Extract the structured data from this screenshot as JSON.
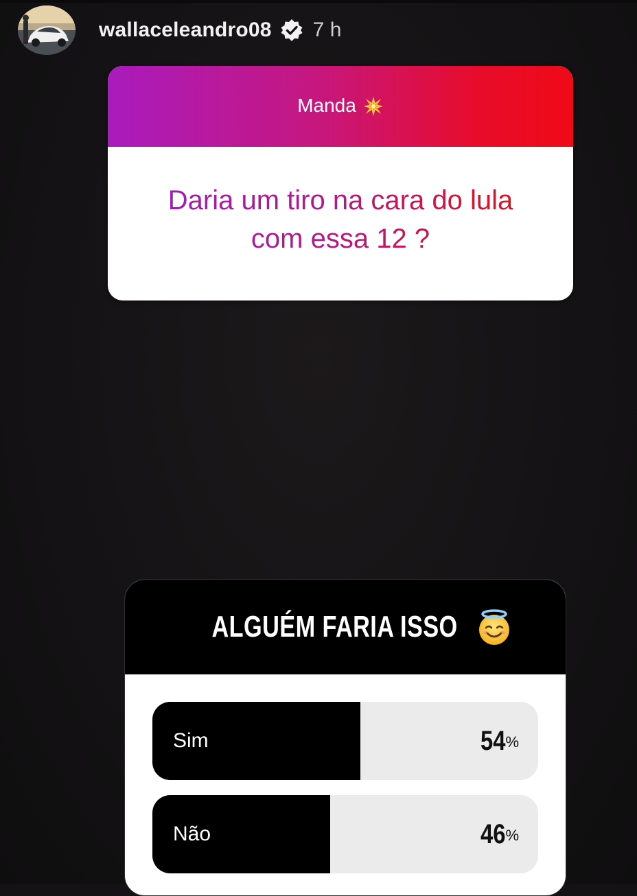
{
  "header": {
    "username": "wallaceleandro08",
    "time": "7 h",
    "avatar_icon": "profile-avatar-car",
    "verified_icon": "verified-badge-icon"
  },
  "question_sticker": {
    "prompt": "Manda",
    "prompt_icon": "sparkle-collision-emoji",
    "text": "Daria um tiro na cara do lula com essa 12 ?",
    "gradient": [
      "#a91bbd",
      "#ef0a16"
    ]
  },
  "poll": {
    "title": "ALGUÉM FARIA ISSO",
    "title_icon": "smiling-face-with-halo-emoji",
    "options": [
      {
        "label": "Sim",
        "percent_value": "54",
        "percent_sign": "%",
        "fill": 0.54
      },
      {
        "label": "Não",
        "percent_value": "46",
        "percent_sign": "%",
        "fill": 0.46
      }
    ]
  },
  "colors": {
    "background": "#141214",
    "poll_fill": "#000000",
    "poll_track": "#ebebeb"
  }
}
